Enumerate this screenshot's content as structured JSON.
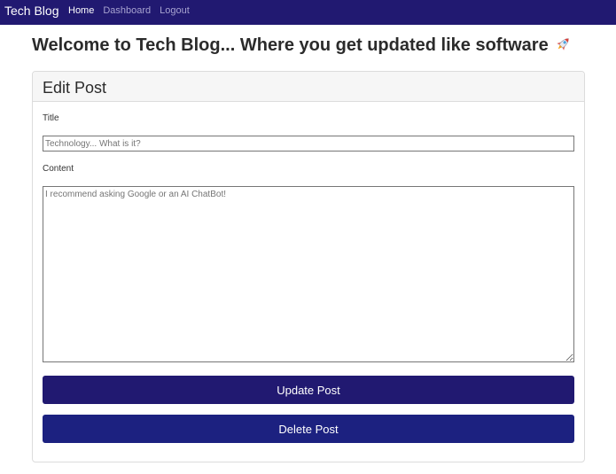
{
  "navbar": {
    "brand": "Tech Blog",
    "links": [
      {
        "label": "Home",
        "active": true
      },
      {
        "label": "Dashboard",
        "active": false
      },
      {
        "label": "Logout",
        "active": false
      }
    ],
    "background": "#211971"
  },
  "page": {
    "title": "Welcome to Tech Blog... Where you get updated like software",
    "title_icon": "rocket-icon"
  },
  "edit_post": {
    "header": "Edit Post",
    "title_label": "Title",
    "title_placeholder": "Technology... What is it?",
    "content_label": "Content",
    "content_placeholder": "I recommend asking Google or an AI ChatBot!",
    "update_button": "Update Post",
    "delete_button": "Delete Post",
    "update_color": "#211971",
    "delete_color": "#1c2180"
  }
}
